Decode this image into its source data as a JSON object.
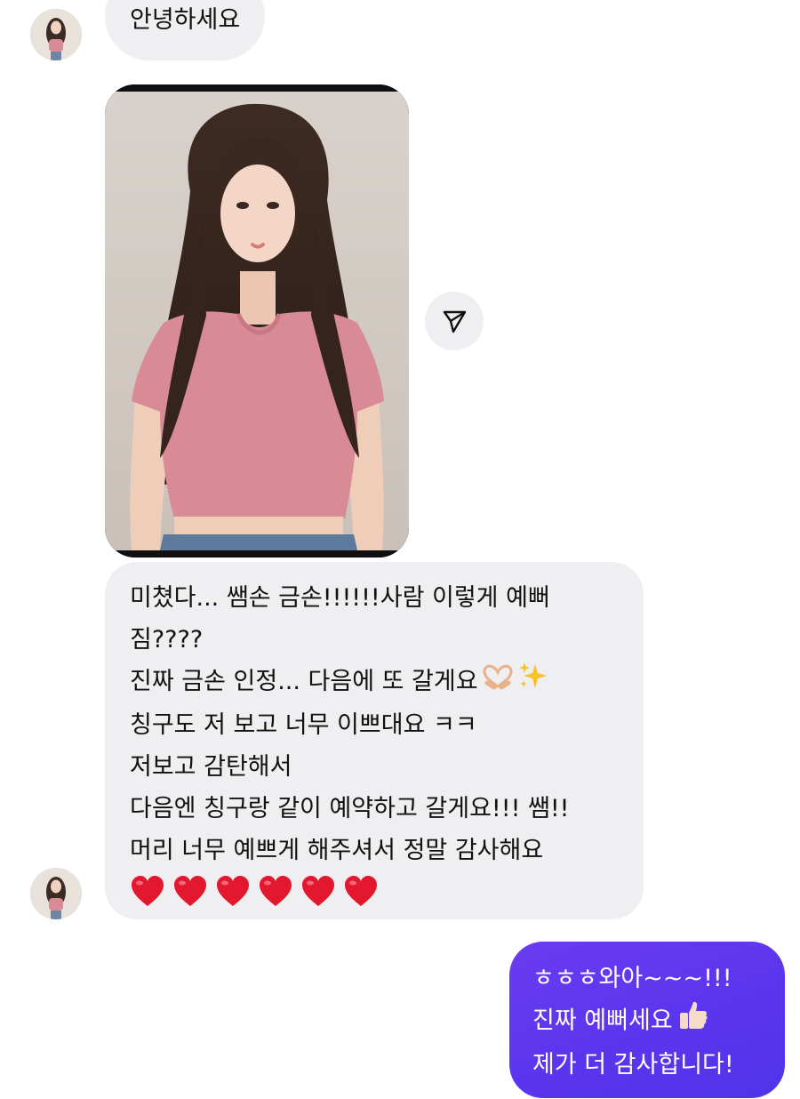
{
  "messages": {
    "greeting": "안녕하세요",
    "long_reply": [
      "미쳤다... 쌤손 금손!!!!!!사람 이렇게 예뻐",
      "짐????",
      "진짜 금손 인정... 다음에 또 갈게요",
      "칭구도 저 보고 너무 이쁘대요 ㅋㅋ",
      "저보고 감탄해서",
      "다음엔 칭구랑 같이 예약하고 갈게요!!! 쌤!!",
      "머리 너무 예쁘게 해주셔서 정말 감사해요"
    ],
    "heart_count": 6,
    "sent_reply": [
      "ㅎㅎㅎ와아~~~!!!",
      "진짜 예뻐세요",
      "제가 더 감사합니다!"
    ]
  },
  "icons": {
    "share": "paper-plane-icon",
    "heart_hands": "heart-hands-emoji",
    "sparkles": "sparkles-emoji",
    "heart": "red-heart-emoji",
    "thumbs_up": "thumbs-up-emoji"
  },
  "colors": {
    "incoming_bubble": "#efeff1",
    "outgoing_bubble": "#5b35ee",
    "heart": "#e3172d",
    "shirt": "#d98b95"
  }
}
